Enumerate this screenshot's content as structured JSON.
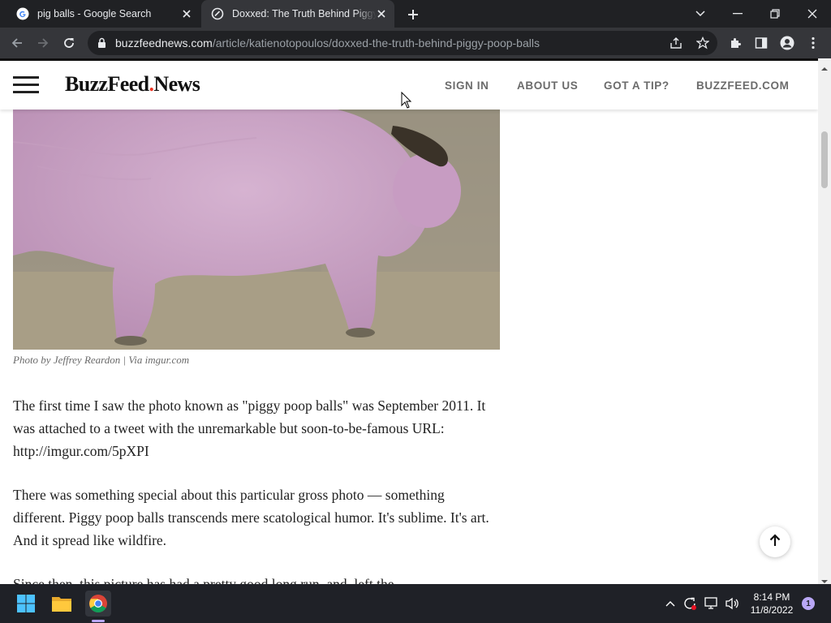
{
  "browser": {
    "tabs": [
      {
        "title": "pig balls - Google Search",
        "favicon": "google-g-icon",
        "active": false
      },
      {
        "title": "Doxxed: The Truth Behind Piggy Poop Balls",
        "favicon": "buzzfeed-news-icon",
        "active": true
      }
    ],
    "url": {
      "domain": "buzzfeednews.com",
      "path": "/article/katienotopoulos/doxxed-the-truth-behind-piggy-poop-balls"
    }
  },
  "site": {
    "logo_main": "BuzzFeed",
    "logo_dot": ".",
    "logo_sub": "News",
    "nav": [
      {
        "label": "SIGN IN"
      },
      {
        "label": "ABOUT US"
      },
      {
        "label": "GOT A TIP?"
      },
      {
        "label": "BUZZFEED.COM"
      }
    ],
    "accent_color": "#e32222"
  },
  "article": {
    "image_caption": "Photo by Jeffrey Reardon | Via imgur.com",
    "paragraphs": [
      "The first time I saw the photo known as \"piggy poop balls\" was September 2011. It was attached to a tweet with the unremarkable but soon-to-be-famous URL: http://imgur.com/5pXPI",
      "There was something special about this particular gross photo — something different. Piggy poop balls transcends mere scatological humor. It's sublime. It's art. And it spread like wildfire.",
      "Since then, this picture has had a pretty good long run, and, left the"
    ]
  },
  "taskbar": {
    "time": "8:14 PM",
    "date": "11/8/2022",
    "notification_count": "1"
  }
}
